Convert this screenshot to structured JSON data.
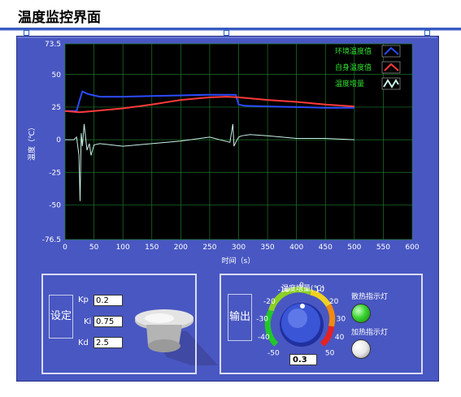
{
  "window": {
    "title": "温度监控界面"
  },
  "chart_data": {
    "type": "line",
    "xlabel": "时间（s）",
    "ylabel": "温度（℃）",
    "xlim": [
      0,
      600
    ],
    "ylim": [
      -76.5,
      73.5
    ],
    "xticks": [
      0,
      50,
      100,
      150,
      200,
      250,
      300,
      350,
      400,
      450,
      500,
      550,
      600
    ],
    "yticks": [
      "73.5",
      "50",
      "25",
      "0",
      "-25",
      "-50",
      "-76.5"
    ],
    "grid": true,
    "legend_position": "top-right",
    "series": [
      {
        "name": "环境温度值",
        "color": "#2b4bff",
        "x": [
          0,
          20,
          25,
          30,
          40,
          60,
          100,
          150,
          200,
          250,
          280,
          295,
          300,
          310,
          350,
          400,
          450,
          500
        ],
        "y": [
          22,
          22,
          30,
          37,
          35,
          33,
          33,
          33.5,
          34,
          34.5,
          34.5,
          34.5,
          27,
          26,
          25.5,
          25,
          24.5,
          24.5
        ]
      },
      {
        "name": "自身温度值",
        "color": "#ff3a3a",
        "x": [
          0,
          25,
          50,
          75,
          100,
          150,
          200,
          250,
          280,
          300,
          350,
          400,
          450,
          500
        ],
        "y": [
          22,
          21,
          22,
          23,
          24,
          27,
          30.5,
          32.5,
          33,
          32.5,
          30.5,
          29,
          27,
          25.5
        ]
      },
      {
        "name": "温度增量",
        "color": "#c8f0e8",
        "x": [
          0,
          15,
          20,
          24,
          26,
          28,
          30,
          33,
          38,
          42,
          45,
          50,
          60,
          80,
          100,
          150,
          200,
          250,
          285,
          290,
          292,
          295,
          300,
          305,
          320,
          350,
          400,
          450,
          500
        ],
        "y": [
          0,
          0,
          2,
          -12,
          -47,
          5,
          -5,
          12,
          -8,
          -3,
          -12,
          -4,
          -3,
          -4,
          -5,
          -3,
          -1,
          2,
          -2,
          12,
          -5,
          -2,
          2,
          3,
          4,
          3,
          1,
          1,
          0
        ]
      }
    ]
  },
  "settings": {
    "button": "设定",
    "kp_label": "Kp",
    "kp_value": "0.2",
    "ki_label": "Ki",
    "ki_value": "0.75",
    "kd_label": "Kd",
    "kd_value": "2.5"
  },
  "output": {
    "button": "输出",
    "knob_title": "温度增量(℃)",
    "knob_ticks": [
      "-50",
      "-40",
      "-30",
      "-20",
      "-10",
      "0",
      "10",
      "20",
      "30",
      "40",
      "50"
    ],
    "knob_value": "0.3",
    "knob_value_num": 0.3,
    "fan_led_label": "散热指示灯",
    "fan_led_color": "#38d430",
    "heat_led_label": "加热指示灯",
    "heat_led_color": "#e8e8e8"
  }
}
